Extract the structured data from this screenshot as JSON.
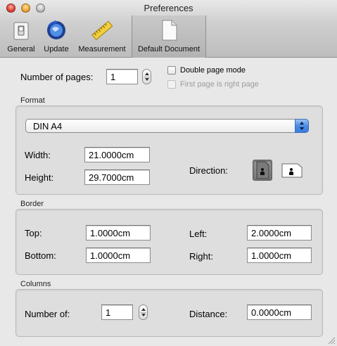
{
  "window": {
    "title": "Preferences"
  },
  "toolbar": {
    "items": [
      {
        "label": "General",
        "icon": "light-switch-icon"
      },
      {
        "label": "Update",
        "icon": "globe-refresh-icon"
      },
      {
        "label": "Measurement",
        "icon": "ruler-icon"
      },
      {
        "label": "Default Document",
        "icon": "blank-document-icon",
        "selected": true
      }
    ]
  },
  "pages": {
    "label": "Number of pages:",
    "value": "1"
  },
  "double_page_mode": {
    "label": "Double page mode",
    "checked": false
  },
  "first_page_right": {
    "label": "First page is right page",
    "checked": false,
    "enabled": false
  },
  "format": {
    "section_label": "Format",
    "paper_size": "DIN A4",
    "width_label": "Width:",
    "width_value": "21.0000cm",
    "height_label": "Height:",
    "height_value": "29.7000cm",
    "direction_label": "Direction:",
    "direction_selected": "portrait"
  },
  "border": {
    "section_label": "Border",
    "top_label": "Top:",
    "top_value": "1.0000cm",
    "bottom_label": "Bottom:",
    "bottom_value": "1.0000cm",
    "left_label": "Left:",
    "left_value": "2.0000cm",
    "right_label": "Right:",
    "right_value": "1.0000cm"
  },
  "columns": {
    "section_label": "Columns",
    "number_label": "Number of:",
    "number_value": "1",
    "distance_label": "Distance:",
    "distance_value": "0.0000cm"
  },
  "colors": {
    "accent": "#4a8ce5",
    "selected_toolbar": "#b8b8b8"
  }
}
